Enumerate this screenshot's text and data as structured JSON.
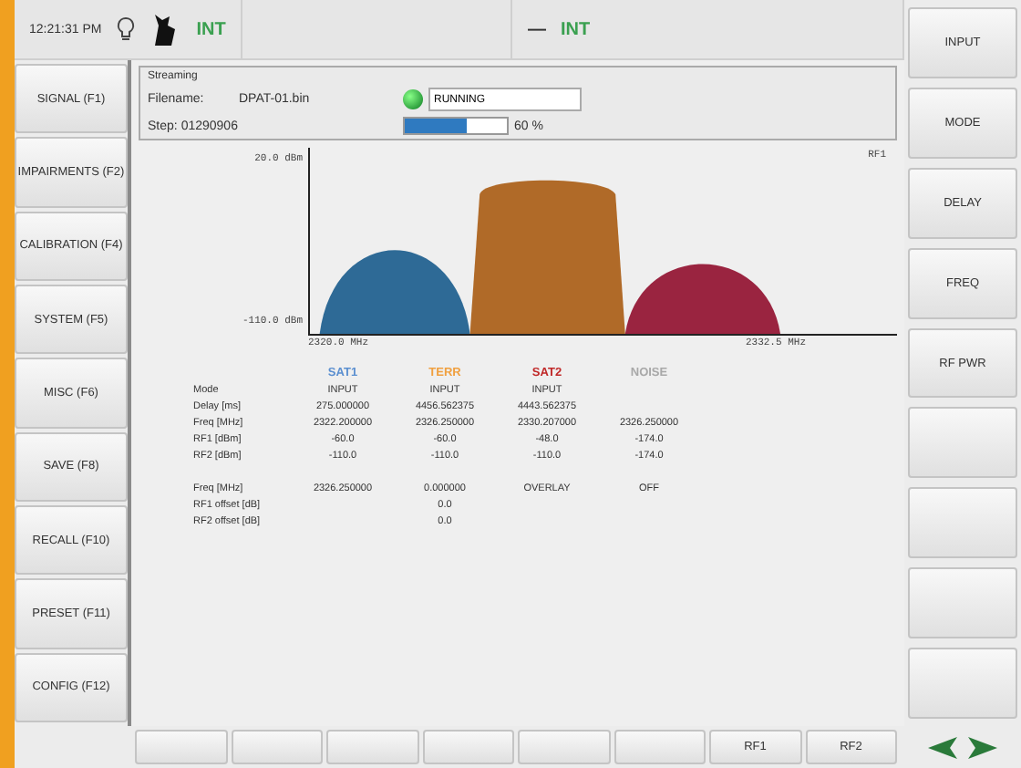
{
  "status_bar": {
    "time": "12:21:31 PM",
    "source_1": "INT",
    "source_2_symbol": "—",
    "source_2": "INT"
  },
  "left_menu": [
    "SIGNAL (F1)",
    "IMPAIRMENTS (F2)",
    "CALIBRATION (F4)",
    "SYSTEM (F5)",
    "MISC (F6)",
    "SAVE (F8)",
    "RECALL (F10)",
    "PRESET (F11)",
    "CONFIG (F12)"
  ],
  "right_menu": [
    "INPUT",
    "MODE",
    "DELAY",
    "FREQ",
    "RF PWR"
  ],
  "streaming": {
    "title": "Streaming",
    "filename_label": "Filename:",
    "filename": "DPAT-01.bin",
    "step_label": "Step:",
    "step": "01290906",
    "level": 0.6,
    "percent": "60 %",
    "running": true,
    "status": "RUNNING"
  },
  "spectrum": {
    "y_top": "20.0 dBm",
    "y_bottom": "-110.0 dBm",
    "x_left": "2320.0 MHz",
    "x_right": "2332.5 MHz",
    "trace": "RF1"
  },
  "table": {
    "columns": [
      {
        "label": "SAT1",
        "color": "#5b8fd0"
      },
      {
        "label": "TERR",
        "color": "#f0a040"
      },
      {
        "label": "SAT2",
        "color": "#c02828"
      },
      {
        "label": "NOISE",
        "color": "#a8a8a8"
      }
    ],
    "rows": [
      {
        "label": "Mode",
        "cells": [
          "INPUT",
          "INPUT",
          "INPUT"
        ]
      },
      {
        "label": "Delay [ms]",
        "cells": [
          "275.000000",
          "4456.562375",
          "4443.562375"
        ]
      },
      {
        "label": "Freq [MHz]",
        "cells": [
          "2322.200000",
          "2326.250000",
          "2330.207000",
          "2326.250000"
        ]
      },
      {
        "label": "RF1 [dBm]",
        "cells": [
          "-60.0",
          "-60.0",
          "-48.0",
          "-174.0"
        ]
      },
      {
        "label": "RF2 [dBm]",
        "cells": [
          "-110.0",
          "-110.0",
          "-110.0",
          "-174.0"
        ]
      }
    ]
  },
  "overlay": {
    "rows": [
      {
        "label": "Freq [MHz]",
        "cells": [
          "2326.250000",
          "0.000000",
          "OVERLAY",
          "OFF"
        ]
      },
      {
        "label": "RF1 offset [dB]",
        "cells": [
          null,
          "0.0"
        ]
      },
      {
        "label": "RF2 offset [dB]",
        "cells": [
          null,
          "0.0"
        ]
      }
    ]
  },
  "bottom_buttons": [
    "RF1",
    "RF2"
  ]
}
